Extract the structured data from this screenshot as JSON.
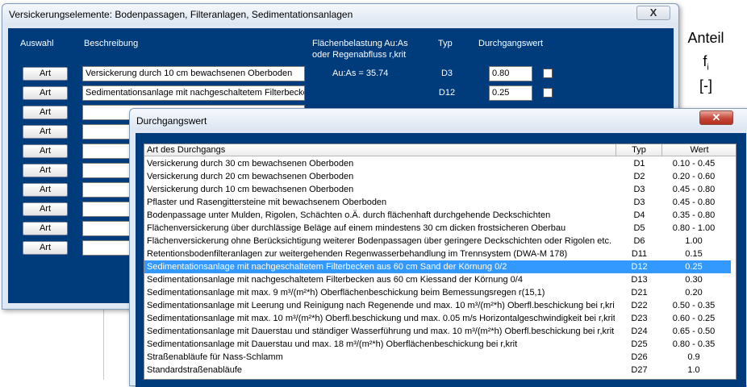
{
  "side_panel": {
    "anteil": "Anteil",
    "f": "f",
    "f_sub": "i",
    "unit": "[-]"
  },
  "main_window": {
    "title": "Versickerungselemente: Bodenpassagen, Filteranlagen, Sedimentationsanlagen",
    "close_label": "X",
    "headers": {
      "auswahl": "Auswahl",
      "beschreibung": "Beschreibung",
      "flaeche_line1": "Flächenbelastung Au:As",
      "flaeche_line2": "oder Regenabfluss r,krit",
      "typ": "Typ",
      "durchgang": "Durchgangswert"
    },
    "art_label": "Art",
    "rows": [
      {
        "beschreibung": "Versickerung durch 10 cm bewachsenen Oberboden",
        "flaeche": "Au:As = 35.74",
        "typ": "D3",
        "wert": "0.80"
      },
      {
        "beschreibung": "Sedimentationsanlage mit nachgeschaltetem Filterbecker",
        "flaeche": "",
        "typ": "D12",
        "wert": "0.25"
      },
      {
        "beschreibung": "",
        "flaeche": "",
        "typ": "",
        "wert": ""
      },
      {
        "beschreibung": "",
        "flaeche": "",
        "typ": "",
        "wert": ""
      },
      {
        "beschreibung": "",
        "flaeche": "",
        "typ": "",
        "wert": ""
      },
      {
        "beschreibung": "",
        "flaeche": "",
        "typ": "",
        "wert": ""
      },
      {
        "beschreibung": "",
        "flaeche": "",
        "typ": "",
        "wert": ""
      },
      {
        "beschreibung": "",
        "flaeche": "",
        "typ": "",
        "wert": ""
      },
      {
        "beschreibung": "",
        "flaeche": "",
        "typ": "",
        "wert": ""
      },
      {
        "beschreibung": "",
        "flaeche": "",
        "typ": "",
        "wert": ""
      }
    ]
  },
  "dialog": {
    "title": "Durchgangswert",
    "close_label": "✕",
    "columns": {
      "art": "Art des Durchgangs",
      "typ": "Typ",
      "wert": "Wert"
    },
    "selected_index": 8,
    "items": [
      {
        "art": "Versickerung durch 30 cm bewachsenen Oberboden",
        "typ": "D1",
        "wert": "0.10 - 0.45"
      },
      {
        "art": "Versickerung durch 20 cm bewachsenen Oberboden",
        "typ": "D2",
        "wert": "0.20 - 0.60"
      },
      {
        "art": "Versickerung durch 10 cm bewachsenen Oberboden",
        "typ": "D3",
        "wert": "0.45 - 0.80"
      },
      {
        "art": "Pflaster und Rasengittersteine mit bewachsenem Oberboden",
        "typ": "D3",
        "wert": "0.45 - 0.80"
      },
      {
        "art": "Bodenpassage unter Mulden, Rigolen, Schächten o.Ä. durch flächenhaft durchgehende Deckschichten",
        "typ": "D4",
        "wert": "0.35 - 0.80"
      },
      {
        "art": "Flächenversickerung über durchlässige Beläge auf einem mindestens 30 cm dicken frostsicheren Oberbau",
        "typ": "D5",
        "wert": "0.80 - 1.00"
      },
      {
        "art": "Flächenversickerung ohne Berücksichtigung weiterer Bodenpassagen über geringere Deckschichten oder Rigolen etc.",
        "typ": "D6",
        "wert": "1.00"
      },
      {
        "art": "Retentionsbodenfilteranlagen zur weitergehenden Regenwasserbehandlung im Trennsystem (DWA-M 178)",
        "typ": "D11",
        "wert": "0.15"
      },
      {
        "art": "Sedimentationsanlage mit nachgeschaltetem Filterbecken aus 60 cm Sand der Körnung 0/2",
        "typ": "D12",
        "wert": "0.25"
      },
      {
        "art": "Sedimentationsanlage mit nachgeschaltetem Filterbecken aus 60 cm Kiessand der Körnung 0/4",
        "typ": "D13",
        "wert": "0.30"
      },
      {
        "art": "Sedimentationsanlage mit max. 9 m³/(m²*h) Oberflächenbeschickung beim Bemessungsregen r(15,1)",
        "typ": "D21",
        "wert": "0.20"
      },
      {
        "art": "Sedimentationsanlage mit Leerung und Reinigung nach Regenende und max. 10 m³/(m²*h) Oberfl.beschickung bei r,krit",
        "typ": "D22",
        "wert": "0.50 - 0.35"
      },
      {
        "art": "Sedimentationsanlage mit max. 10 m³/(m²*h) Oberfl.beschickung und max. 0.05 m/s Horizontalgeschwindigkeit bei r,krit",
        "typ": "D23",
        "wert": "0.60 - 0.25"
      },
      {
        "art": "Sedimentationsanlage mit Dauerstau und ständiger Wasserführung und max. 10 m³/(m²*h) Oberfl.beschickung bei r,krit",
        "typ": "D24",
        "wert": "0.65 - 0.50"
      },
      {
        "art": "Sedimentationsanlage mit Dauerstau und max. 18 m³/(m²*h) Oberflächenbeschickung bei r,krit",
        "typ": "D25",
        "wert": "0.80 - 0.35"
      },
      {
        "art": "Straßenabläufe für Nass-Schlamm",
        "typ": "D26",
        "wert": "0.9"
      },
      {
        "art": "Standardstraßenabläufe",
        "typ": "D27",
        "wert": "1.0"
      }
    ]
  },
  "colors": {
    "client_bg": "#003b7b",
    "selection": "#3399ff",
    "close_red": "#c7463a"
  }
}
